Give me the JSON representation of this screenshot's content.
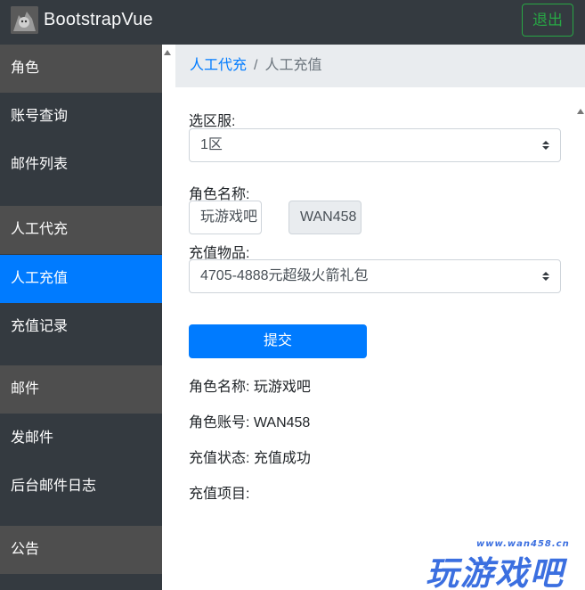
{
  "navbar": {
    "brand": "BootstrapVue",
    "logout_label": "退出"
  },
  "sidebar": {
    "items": [
      {
        "label": "角色",
        "type": "group"
      },
      {
        "label": "账号查询",
        "type": "item"
      },
      {
        "label": "邮件列表",
        "type": "item"
      },
      {
        "label": "人工代充",
        "type": "group"
      },
      {
        "label": "人工充值",
        "type": "active"
      },
      {
        "label": "充值记录",
        "type": "item"
      },
      {
        "label": "邮件",
        "type": "group"
      },
      {
        "label": "发邮件",
        "type": "item"
      },
      {
        "label": "后台邮件日志",
        "type": "item"
      },
      {
        "label": "公告",
        "type": "group"
      }
    ]
  },
  "breadcrumb": {
    "parent": "人工代充",
    "separator": "/",
    "current": "人工充值"
  },
  "form": {
    "server_label": "选区服:",
    "server_value": "1区",
    "role_name_label": "角色名称:",
    "role_name_value": "玩游戏吧",
    "account_value": "WAN458",
    "item_label": "充值物品:",
    "item_value": "4705-4888元超级火箭礼包",
    "submit_label": "提交"
  },
  "result": {
    "role_name": "角色名称: 玩游戏吧",
    "role_account": "角色账号: WAN458",
    "status": "充值状态: 充值成功",
    "project": "充值项目:"
  },
  "watermark": {
    "url": "www.wan458.cn",
    "text": "玩游戏吧"
  }
}
